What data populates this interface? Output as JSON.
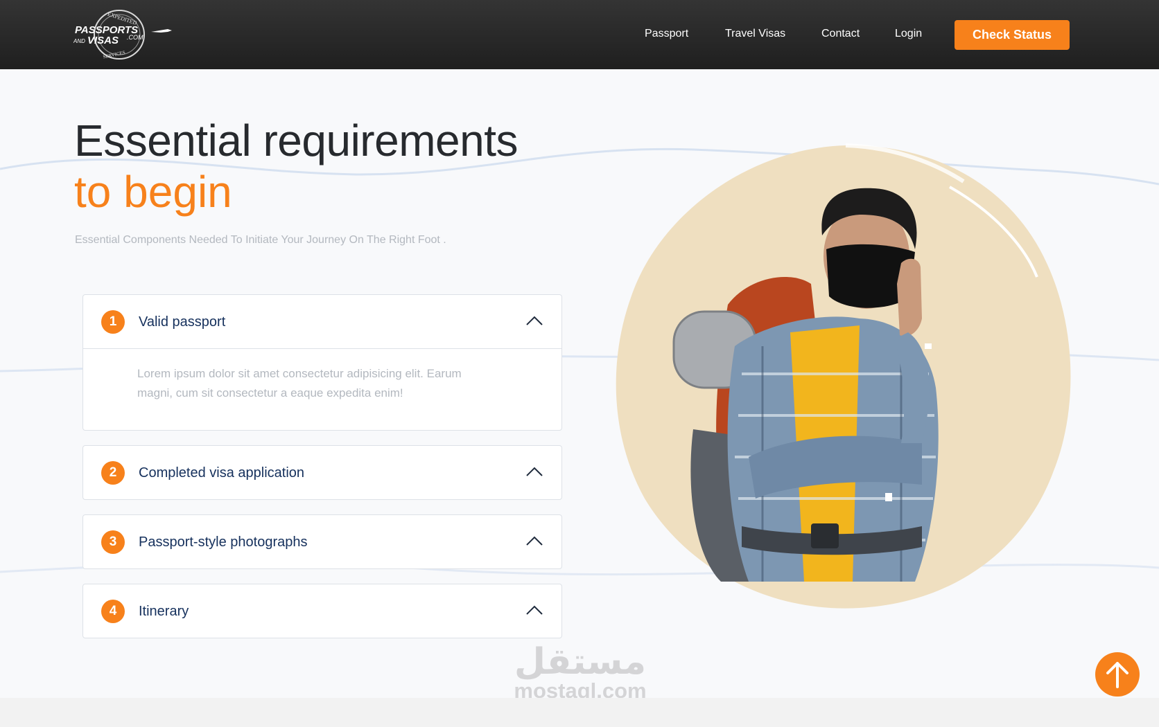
{
  "header": {
    "logo": {
      "line_top": "EXPEDITED",
      "line_main": "PASSPORTS",
      "line_and": "AND",
      "line_visas": "VISAS",
      "line_com": ".COM",
      "line_bottom": "SERVICES"
    },
    "nav": [
      "Passport",
      "Travel Visas",
      "Contact",
      "Login"
    ],
    "cta": "Check Status"
  },
  "hero": {
    "title_line1": "Essential requirements",
    "title_line2": "to begin",
    "subtitle": "Essential Components Needed To Initiate Your Journey On The Right Foot ."
  },
  "requirements": [
    {
      "number": "1",
      "title": "Valid passport",
      "expanded": true,
      "body": "Lorem ipsum dolor sit amet consectetur adipisicing elit. Earum magni, cum sit consectetur a eaque expedita enim!"
    },
    {
      "number": "2",
      "title": "Completed visa application",
      "expanded": false
    },
    {
      "number": "3",
      "title": "Passport-style photographs",
      "expanded": false
    },
    {
      "number": "4",
      "title": "Itinerary",
      "expanded": false
    }
  ],
  "watermark": {
    "arabic": "مستقل",
    "latin": "mostaql.com"
  },
  "colors": {
    "accent": "#f7811b",
    "heading": "#272a2e",
    "navy": "#15305c",
    "muted": "#b3b8bf",
    "blob": "#efdfc0"
  },
  "icons": {
    "chevron": "chevron-up-icon",
    "scroll_top": "arrow-up-icon"
  }
}
